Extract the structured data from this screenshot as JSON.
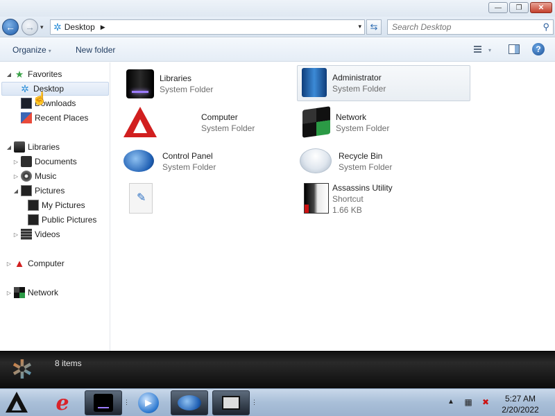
{
  "window": {
    "controls": {
      "minimize": "—",
      "maximize": "❐",
      "close": "✕"
    }
  },
  "address": {
    "location": "Desktop",
    "search_placeholder": "Search Desktop"
  },
  "toolbar": {
    "organize": "Organize",
    "new_folder": "New folder"
  },
  "nav": {
    "favorites": "Favorites",
    "desktop": "Desktop",
    "downloads": "Downloads",
    "recent_places": "Recent Places",
    "libraries": "Libraries",
    "documents": "Documents",
    "music": "Music",
    "pictures": "Pictures",
    "my_pictures": "My Pictures",
    "public_pictures": "Public Pictures",
    "videos": "Videos",
    "computer": "Computer",
    "network": "Network"
  },
  "items": [
    {
      "name": "Libraries",
      "type": "System Folder"
    },
    {
      "name": "Administrator",
      "type": "System Folder"
    },
    {
      "name": "Computer",
      "type": "System Folder"
    },
    {
      "name": "Network",
      "type": "System Folder"
    },
    {
      "name": "Control Panel",
      "type": "System Folder"
    },
    {
      "name": "Recycle Bin",
      "type": "System Folder"
    },
    {
      "name": "",
      "type": ""
    },
    {
      "name": "Assassins Utility",
      "type": "Shortcut",
      "size": "1.66 KB"
    }
  ],
  "details": {
    "count": "8 items"
  },
  "taskbar": {
    "time": "5:27 AM",
    "date": "2/20/2022"
  },
  "colors": {
    "accent": "#2d8fd8",
    "taskbar": "#a9bfd8",
    "details_bg": "#101010"
  },
  "icons": [
    "desktop-star-icon",
    "back-arrow-icon",
    "forward-arrow-icon",
    "refresh-icon",
    "search-icon",
    "views-icon",
    "preview-pane-icon",
    "help-icon"
  ]
}
